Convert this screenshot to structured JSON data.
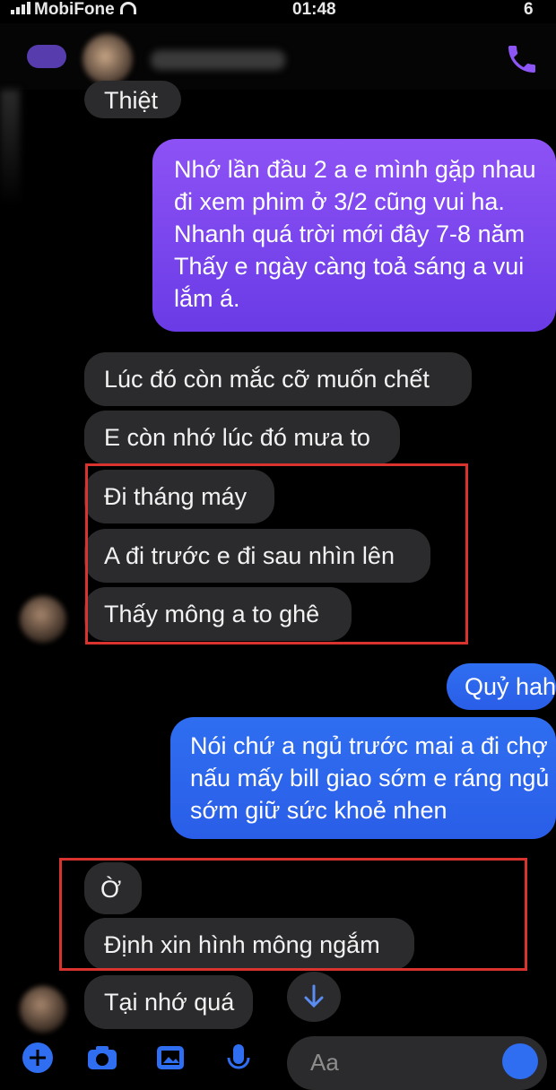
{
  "status": {
    "carrier": "MobiFone",
    "time": "01:48",
    "battery": "6"
  },
  "colors": {
    "incoming_bubble": "#2b2b2d",
    "outgoing_purple": "#7a45ee",
    "outgoing_blue": "#2f6ef0",
    "highlight_box": "#d8332f",
    "accent": "#8e55f7"
  },
  "header": {
    "back_icon": "back-icon",
    "call_icon": "phone-icon"
  },
  "messages": [
    {
      "text": "Thiệt"
    },
    {
      "text": "Nhớ lần đầu 2 a e mình gặp nhau\nđi xem phim ở 3/2 cũng vui ha.\nNhanh quá trời mới đây 7-8 năm\nThấy e ngày càng toả sáng a vui\nlắm á."
    },
    {
      "text": "Lúc đó còn mắc cỡ muốn chết"
    },
    {
      "text": "E còn nhớ lúc đó mưa to"
    },
    {
      "text": "Đi tháng máy"
    },
    {
      "text": "A đi trước e đi sau nhìn lên"
    },
    {
      "text": "Thấy mông a to ghê"
    },
    {
      "text": "Quỷ hah"
    },
    {
      "text": "Nói chứ a ngủ trước mai a đi chợ\nnấu mấy bill giao sớm e ráng ngủ\nsớm giữ sức khoẻ nhen"
    },
    {
      "text": "Ờ"
    },
    {
      "text": "Định xin hình mông ngắm"
    },
    {
      "text": "Tại nhớ quá"
    }
  ],
  "composer": {
    "placeholder": "Aa",
    "icons": [
      "plus-icon",
      "camera-icon",
      "gallery-icon",
      "mic-icon",
      "emoji-icon"
    ]
  },
  "scroll_icon": "arrow-down-icon"
}
